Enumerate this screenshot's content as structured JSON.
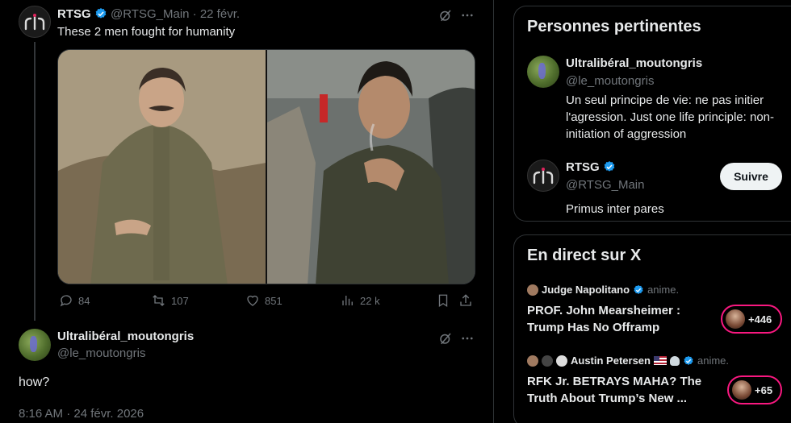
{
  "tweet1": {
    "name": "RTSG",
    "handle": "@RTSG_Main",
    "date": "· 22 févr.",
    "text": "These 2 men fought for humanity",
    "stats": {
      "replies": "84",
      "retweets": "107",
      "likes": "851",
      "views": "22 k"
    }
  },
  "tweet2": {
    "name": "Ultralibéral_moutongris",
    "handle": "@le_moutongris",
    "text": "how?",
    "timestamp": "8:16 AM · 24 févr. 2026"
  },
  "people": {
    "title": "Personnes pertinentes",
    "items": [
      {
        "name": "Ultralibéral_moutongris",
        "handle": "@le_moutongris",
        "bio": "Un seul principe de vie: ne pas initier l'agression. Just one life principle: non-initiation of aggression"
      },
      {
        "name": "RTSG",
        "handle": "@RTSG_Main",
        "bio": "Primus inter pares",
        "follow_label": "Suivre"
      }
    ]
  },
  "live": {
    "title": "En direct sur X",
    "items": [
      {
        "host": "Judge Napolitano",
        "status": "anime.",
        "title": "PROF.  John Mearsheimer  : Trump Has No Offramp",
        "count": "+446"
      },
      {
        "host": "Austin Petersen",
        "status": "anime.",
        "title": "RFK Jr. BETRAYS MAHA? The Truth About Trump’s New ...",
        "count": "+65"
      }
    ]
  },
  "colors": {
    "accent": "#1d9bf0",
    "live_ring": "#f91880",
    "muted": "#71767b",
    "border": "#2f3336"
  }
}
